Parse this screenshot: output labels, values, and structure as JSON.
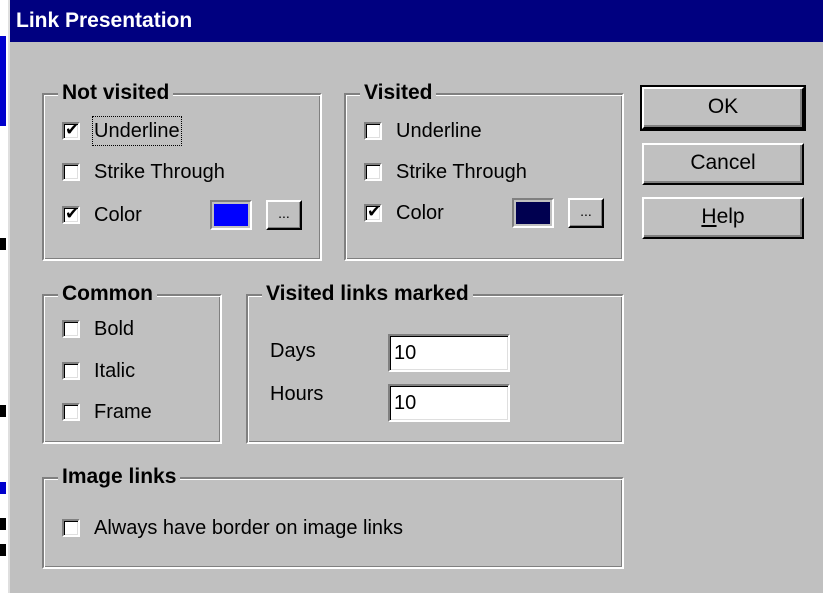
{
  "window": {
    "title": "Link Presentation"
  },
  "not_visited": {
    "legend": "Not visited",
    "underline": {
      "label": "Underline",
      "checked": true
    },
    "strike_through": {
      "label": "Strike Through",
      "checked": false
    },
    "color": {
      "label": "Color",
      "checked": true,
      "swatch": "#0000ff",
      "browse_label": "..."
    }
  },
  "visited": {
    "legend": "Visited",
    "underline": {
      "label": "Underline",
      "checked": false
    },
    "strike_through": {
      "label": "Strike Through",
      "checked": false
    },
    "color": {
      "label": "Color",
      "checked": true,
      "swatch": "#000050",
      "browse_label": "..."
    }
  },
  "common": {
    "legend": "Common",
    "bold": {
      "label": "Bold",
      "checked": false
    },
    "italic": {
      "label": "Italic",
      "checked": false
    },
    "frame": {
      "label": "Frame",
      "checked": false
    }
  },
  "visited_marked": {
    "legend": "Visited links marked",
    "days_label": "Days",
    "days_value": "10",
    "hours_label": "Hours",
    "hours_value": "10"
  },
  "image_links": {
    "legend": "Image links",
    "always_border": {
      "label": "Always have border on image links",
      "checked": false
    }
  },
  "buttons": {
    "ok": "OK",
    "cancel": "Cancel",
    "help_prefix": "H",
    "help_rest": "elp"
  },
  "colors": {
    "titlebar": "#000080",
    "face": "#c0c0c0"
  }
}
